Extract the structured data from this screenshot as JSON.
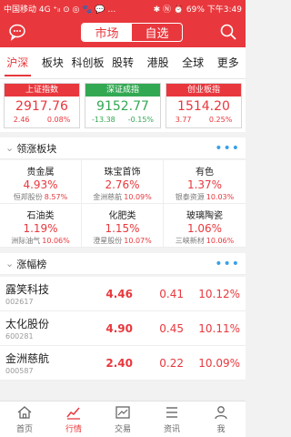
{
  "status_bar": {
    "left": "中国移动 4G ⁺ᵢₗ ⊙ ◎ 🐾 💬 …",
    "right": "✱ Ⓝ ⏰ 69% 下午3:49"
  },
  "nav": {
    "segments": [
      "市场",
      "自选"
    ],
    "active_segment": "市场"
  },
  "tabs": [
    "沪深",
    "板块",
    "科创板",
    "股转",
    "港股",
    "全球",
    "更多"
  ],
  "active_tab": "沪深",
  "indices": [
    {
      "name": "上证指数",
      "value": "2917.76",
      "change": "2.46",
      "percent": "0.08%",
      "trend": "up"
    },
    {
      "name": "深证成指",
      "value": "9152.77",
      "change": "-13.38",
      "percent": "-0.15%",
      "trend": "down"
    },
    {
      "name": "创业板指",
      "value": "1514.20",
      "change": "3.77",
      "percent": "0.25%",
      "trend": "up"
    }
  ],
  "sectors_section": {
    "title": "领涨板块"
  },
  "sectors": [
    {
      "name": "贵金属",
      "percent": "4.93%",
      "leader": "恒邦股份",
      "leader_pct": "8.57%"
    },
    {
      "name": "珠宝首饰",
      "percent": "2.76%",
      "leader": "金洲慈航",
      "leader_pct": "10.09%"
    },
    {
      "name": "有色",
      "percent": "1.37%",
      "leader": "银泰资源",
      "leader_pct": "10.03%"
    },
    {
      "name": "石油类",
      "percent": "1.19%",
      "leader": "洲际油气",
      "leader_pct": "10.06%"
    },
    {
      "name": "化肥类",
      "percent": "1.15%",
      "leader": "澄星股份",
      "leader_pct": "10.07%"
    },
    {
      "name": "玻璃陶瓷",
      "percent": "1.06%",
      "leader": "三峡新材",
      "leader_pct": "10.06%"
    }
  ],
  "gainers_section": {
    "title": "涨幅榜"
  },
  "gainers": [
    {
      "name": "露笑科技",
      "code": "002617",
      "price": "4.46",
      "change": "0.41",
      "percent": "10.12%"
    },
    {
      "name": "太化股份",
      "code": "600281",
      "price": "4.90",
      "change": "0.45",
      "percent": "10.11%"
    },
    {
      "name": "金洲慈航",
      "code": "000587",
      "price": "2.40",
      "change": "0.22",
      "percent": "10.09%"
    }
  ],
  "bottom_nav": [
    {
      "label": "首页",
      "icon": "home-icon"
    },
    {
      "label": "行情",
      "icon": "chart-icon"
    },
    {
      "label": "交易",
      "icon": "trade-icon"
    },
    {
      "label": "资讯",
      "icon": "news-icon"
    },
    {
      "label": "我",
      "icon": "person-icon"
    }
  ],
  "active_bottom": "行情",
  "colors": {
    "brand": "#e8383d",
    "down": "#33a853",
    "accent": "#3aa0e8"
  }
}
